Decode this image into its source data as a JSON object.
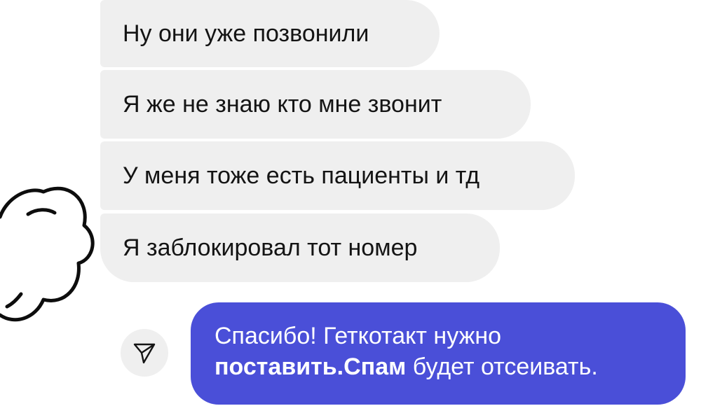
{
  "messages_in": [
    {
      "text": "Ну они уже позвонили"
    },
    {
      "text": "Я же не знаю кто мне звонит"
    },
    {
      "text": "У меня тоже есть пациенты и тд"
    },
    {
      "text": "Я заблокировал тот номер"
    }
  ],
  "message_out": {
    "line1": "Спасибо! Геткотакт нужно",
    "line2_bold": "поставить.Спам",
    "line2_rest": " будет отсеивать."
  },
  "icons": {
    "share": "send-icon",
    "cloud": "cloud-scribble-icon"
  },
  "colors": {
    "incoming_bubble": "#efefef",
    "outgoing_bubble": "#4a4fd8",
    "text_dark": "#141414",
    "text_light": "#ffffff"
  }
}
